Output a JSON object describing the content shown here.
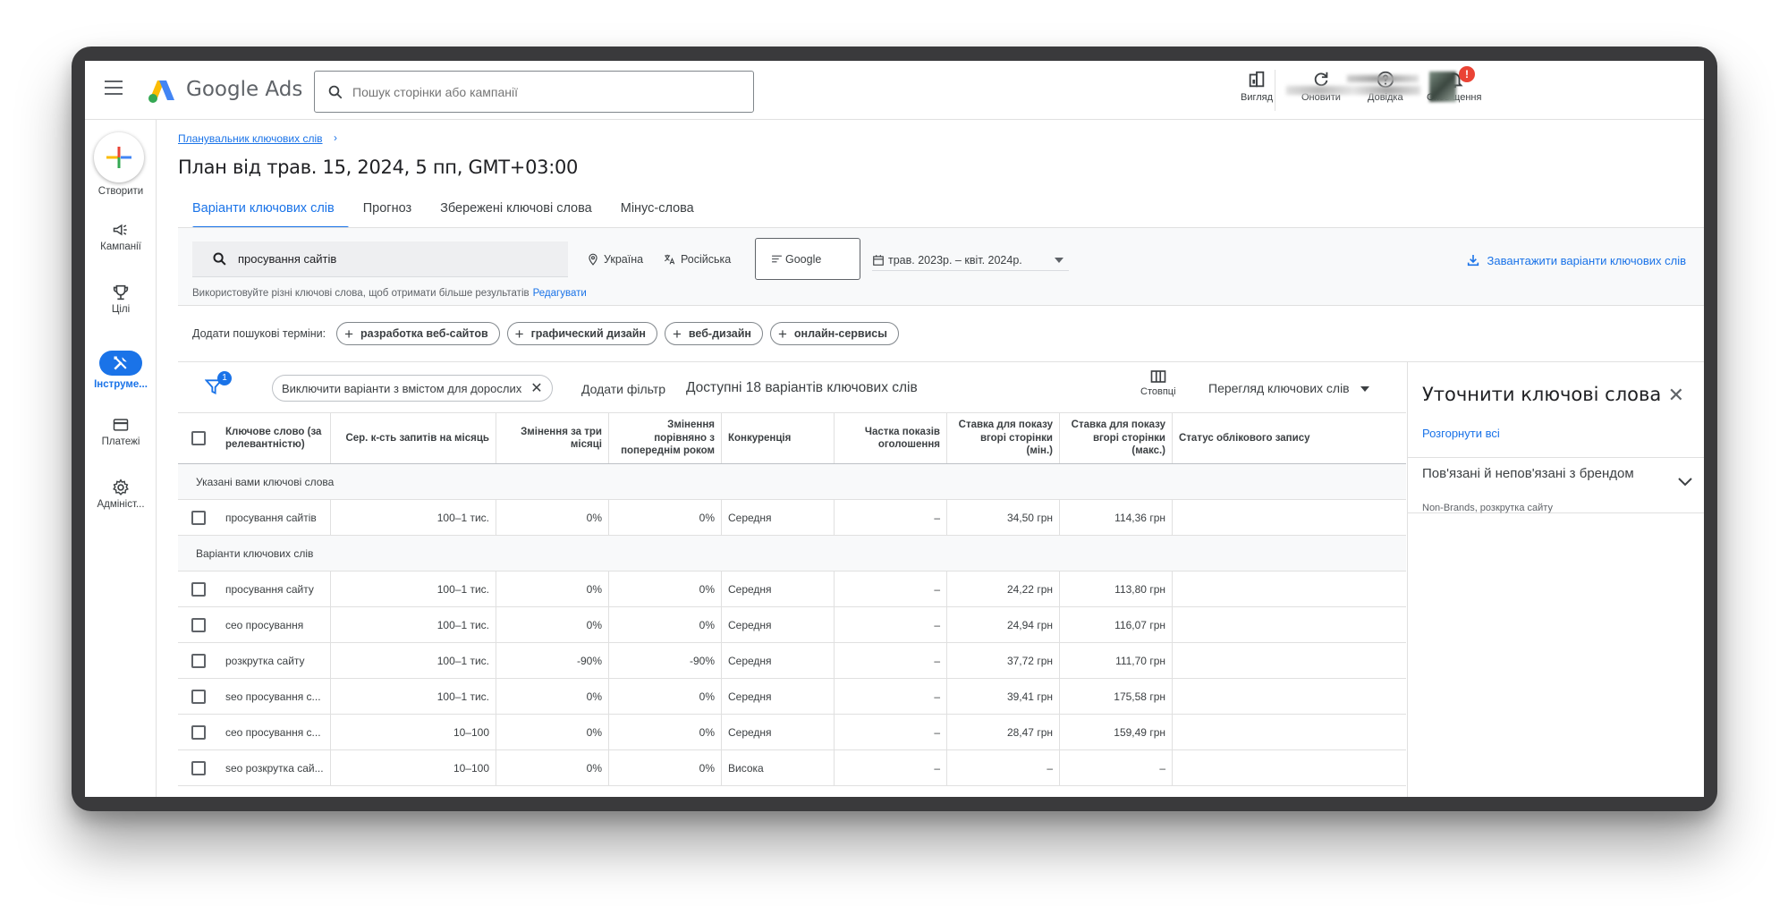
{
  "app": {
    "logo_text": "Google Ads",
    "search_placeholder": "Пошук сторінки або кампанії"
  },
  "topbar": {
    "view_label": "Вигляд",
    "refresh_label": "Оновити",
    "help_label": "Довідка",
    "notifications_label": "Сповіщення",
    "notifications_badge": "!"
  },
  "leftnav": {
    "create_label": "Створити",
    "items": [
      {
        "label": "Кампанії",
        "icon": "megaphone-icon"
      },
      {
        "label": "Цілі",
        "icon": "trophy-icon"
      },
      {
        "label": "Інструме...",
        "icon": "tools-icon"
      },
      {
        "label": "Платежі",
        "icon": "credit-card-icon"
      },
      {
        "label": "Адмініст...",
        "icon": "gear-icon"
      }
    ]
  },
  "page": {
    "breadcrumb": "Планувальник ключових слів",
    "breadcrumb_chevron": "›",
    "title": "План від трав. 15, 2024, 5 пп, GMT+03:00",
    "tabs": [
      "Варіанти ключових слів",
      "Прогноз",
      "Збережені ключові слова",
      "Мінус-слова"
    ]
  },
  "filters": {
    "keyword": "просування сайтів",
    "location": "Україна",
    "language": "Російська",
    "network": "Google",
    "date_range": "трав. 2023р. – квіт. 2024р.",
    "download": "Завантажити варіанти ключових слів",
    "hint": "Використовуйте різні ключові слова, щоб отримати більше результатів",
    "hint_link": "Редагувати"
  },
  "add_terms": {
    "label": "Додати пошукові терміни:",
    "chips": [
      "разработка веб-сайтов",
      "графический дизайн",
      "веб-дизайн",
      "онлайн-сервисы"
    ]
  },
  "table_toolbar": {
    "filter_count": "1",
    "filter_chip": "Виключити варіанти з вмістом для дорослих",
    "add_filter": "Додати фільтр",
    "available": "Доступні 18 варіантів ключових слів",
    "columns_label": "Стовпці",
    "view_select": "Перегляд ключових слів"
  },
  "table": {
    "headers": [
      "Ключове слово (за релевантністю)",
      "Сер. к-сть запитів на місяць",
      "Змінення за три місяці",
      "Змінення порівняно з попереднім роком",
      "Конкуренція",
      "Частка показів оголошення",
      "Ставка для показу вгорі сторінки (мін.)",
      "Ставка для показу вгорі сторінки (макс.)",
      "Статус облікового запису"
    ],
    "group1": "Указані вами ключові слова",
    "group1_rows": [
      [
        "просування сайтів",
        "100–1 тис.",
        "0%",
        "0%",
        "Середня",
        "–",
        "34,50 грн",
        "114,36 грн",
        ""
      ]
    ],
    "group2": "Варіанти ключових слів",
    "group2_rows": [
      [
        "просування сайту",
        "100–1 тис.",
        "0%",
        "0%",
        "Середня",
        "–",
        "24,22 грн",
        "113,80 грн",
        ""
      ],
      [
        "сео просування",
        "100–1 тис.",
        "0%",
        "0%",
        "Середня",
        "–",
        "24,94 грн",
        "116,07 грн",
        ""
      ],
      [
        "розкрутка сайту",
        "100–1 тис.",
        "-90%",
        "-90%",
        "Середня",
        "–",
        "37,72 грн",
        "111,70 грн",
        ""
      ],
      [
        "seo просування с...",
        "100–1 тис.",
        "0%",
        "0%",
        "Середня",
        "–",
        "39,41 грн",
        "175,58 грн",
        ""
      ],
      [
        "сео просування с...",
        "10–100",
        "0%",
        "0%",
        "Середня",
        "–",
        "28,47 грн",
        "159,49 грн",
        ""
      ],
      [
        "seo розкрутка сай...",
        "10–100",
        "0%",
        "0%",
        "Висока",
        "–",
        "–",
        "–",
        ""
      ]
    ]
  },
  "refine_panel": {
    "title": "Уточнити ключові слова",
    "expand_all": "Розгорнути всі",
    "section_title": "Пов'язані й непов'язані з брендом",
    "section_sub": "Non-Brands, розкрутка сайту"
  },
  "colors": {
    "accent": "#1a73e8",
    "badge": "#ea4335"
  }
}
